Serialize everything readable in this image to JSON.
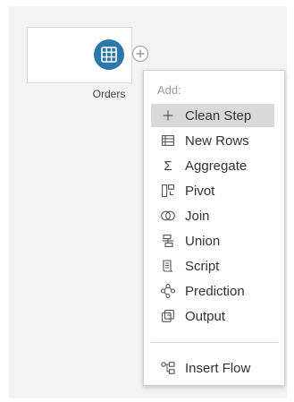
{
  "step": {
    "label": "Orders",
    "icon": "table-icon",
    "color": "#2b78a8"
  },
  "add_button": {
    "icon": "plus-circle-icon"
  },
  "menu": {
    "header": "Add:",
    "items": [
      {
        "label": "Clean Step",
        "icon": "plus-icon",
        "highlighted": true
      },
      {
        "label": "New Rows",
        "icon": "new-rows-icon"
      },
      {
        "label": "Aggregate",
        "icon": "sigma-icon"
      },
      {
        "label": "Pivot",
        "icon": "pivot-icon"
      },
      {
        "label": "Join",
        "icon": "join-icon"
      },
      {
        "label": "Union",
        "icon": "union-icon"
      },
      {
        "label": "Script",
        "icon": "script-icon"
      },
      {
        "label": "Prediction",
        "icon": "prediction-icon"
      },
      {
        "label": "Output",
        "icon": "output-icon"
      }
    ],
    "footer_item": {
      "label": "Insert Flow",
      "icon": "insert-flow-icon"
    }
  }
}
